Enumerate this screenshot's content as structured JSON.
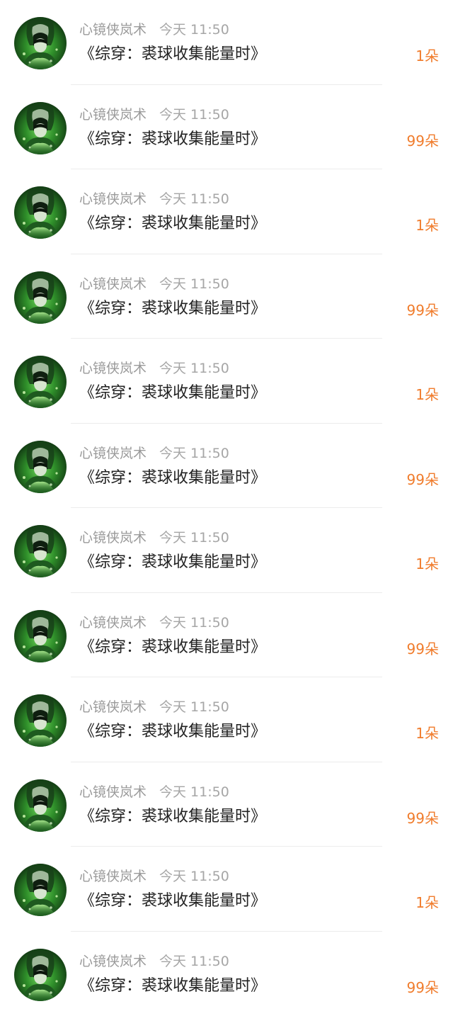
{
  "colors": {
    "accent": "#f07c2c",
    "meta_text": "#9a9a9a",
    "title_text": "#222222",
    "divider": "#ececec",
    "avatar_green": "#2f8f2a"
  },
  "items": [
    {
      "user": "心镜侠岚术",
      "time": "今天 11:50",
      "title": "《综穿：裘球收集能量时》",
      "gift": "1朵"
    },
    {
      "user": "心镜侠岚术",
      "time": "今天 11:50",
      "title": "《综穿：裘球收集能量时》",
      "gift": "99朵"
    },
    {
      "user": "心镜侠岚术",
      "time": "今天 11:50",
      "title": "《综穿：裘球收集能量时》",
      "gift": "1朵"
    },
    {
      "user": "心镜侠岚术",
      "time": "今天 11:50",
      "title": "《综穿：裘球收集能量时》",
      "gift": "99朵"
    },
    {
      "user": "心镜侠岚术",
      "time": "今天 11:50",
      "title": "《综穿：裘球收集能量时》",
      "gift": "1朵"
    },
    {
      "user": "心镜侠岚术",
      "time": "今天 11:50",
      "title": "《综穿：裘球收集能量时》",
      "gift": "99朵"
    },
    {
      "user": "心镜侠岚术",
      "time": "今天 11:50",
      "title": "《综穿：裘球收集能量时》",
      "gift": "1朵"
    },
    {
      "user": "心镜侠岚术",
      "time": "今天 11:50",
      "title": "《综穿：裘球收集能量时》",
      "gift": "99朵"
    },
    {
      "user": "心镜侠岚术",
      "time": "今天 11:50",
      "title": "《综穿：裘球收集能量时》",
      "gift": "1朵"
    },
    {
      "user": "心镜侠岚术",
      "time": "今天 11:50",
      "title": "《综穿：裘球收集能量时》",
      "gift": "99朵"
    },
    {
      "user": "心镜侠岚术",
      "time": "今天 11:50",
      "title": "《综穿：裘球收集能量时》",
      "gift": "1朵"
    },
    {
      "user": "心镜侠岚术",
      "time": "今天 11:50",
      "title": "《综穿：裘球收集能量时》",
      "gift": "99朵"
    }
  ]
}
